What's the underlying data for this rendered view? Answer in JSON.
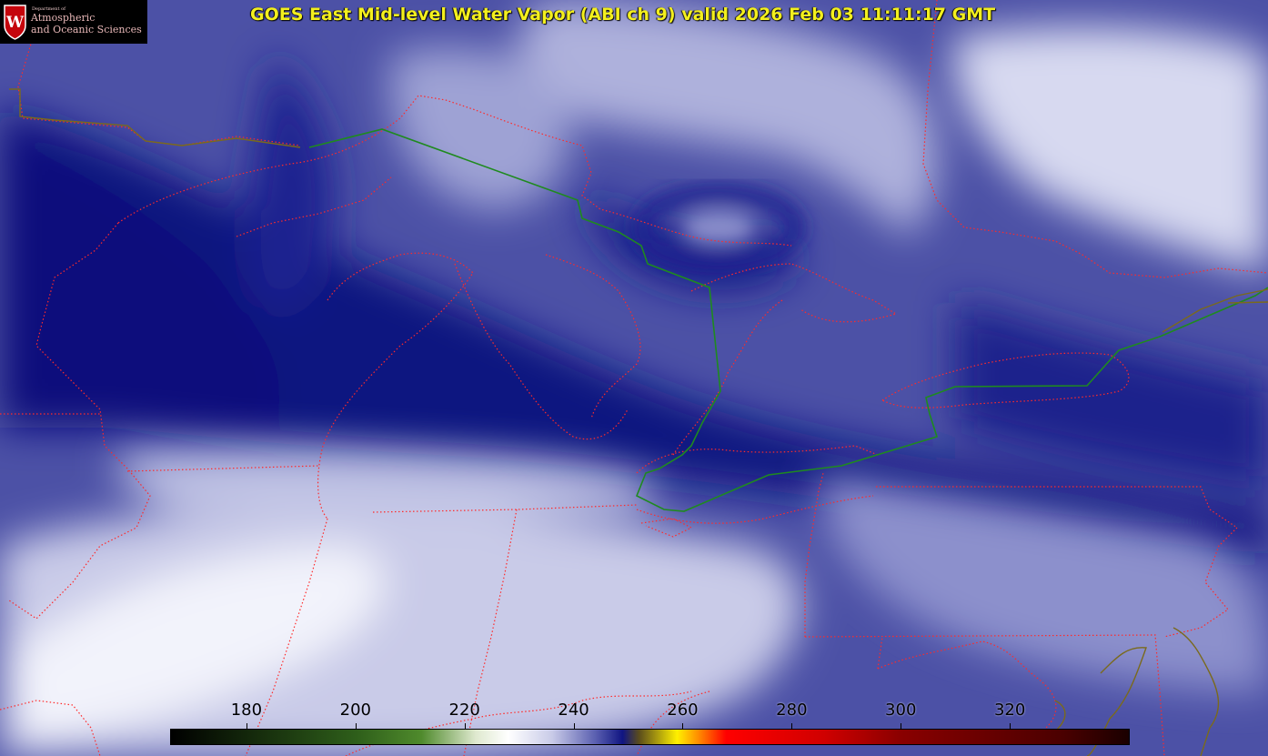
{
  "header": {
    "title": "GOES East Mid-level Water Vapor (ABI ch 9)  valid 2026 Feb 03 11:11:17 GMT"
  },
  "logo": {
    "department": "Department of",
    "line1": "Atmospheric",
    "line2": "and Oceanic Sciences",
    "crest_letter": "W"
  },
  "colorbar": {
    "units_ticks": [
      "180",
      "200",
      "220",
      "240",
      "260",
      "280",
      "300",
      "320"
    ],
    "tick_values": [
      180,
      200,
      220,
      240,
      260,
      280,
      300,
      320
    ],
    "range": [
      166,
      342
    ],
    "color_stops": [
      {
        "value": 166,
        "color": "#000000"
      },
      {
        "value": 200,
        "color": "#2e5e1a"
      },
      {
        "value": 212,
        "color": "#4f8a2c"
      },
      {
        "value": 222,
        "color": "#dfe9cf"
      },
      {
        "value": 228,
        "color": "#ffffff"
      },
      {
        "value": 236,
        "color": "#c9cbe8"
      },
      {
        "value": 244,
        "color": "#5a5fb0"
      },
      {
        "value": 249,
        "color": "#101582"
      },
      {
        "value": 252,
        "color": "#5a4c1c"
      },
      {
        "value": 259,
        "color": "#fff000"
      },
      {
        "value": 263,
        "color": "#ff8a00"
      },
      {
        "value": 268,
        "color": "#ff0000"
      },
      {
        "value": 286,
        "color": "#d00000"
      },
      {
        "value": 300,
        "color": "#8a0000"
      },
      {
        "value": 330,
        "color": "#4a0000"
      },
      {
        "value": 342,
        "color": "#1a0000"
      }
    ]
  },
  "map": {
    "colors": {
      "background": "#2a2f8a",
      "moist": "#e6e8f6",
      "dry": "#0d1380",
      "state_borders": "#ff2a2a",
      "intl_border": "#1f8a1f",
      "coastline": "#6e5a1a"
    }
  }
}
